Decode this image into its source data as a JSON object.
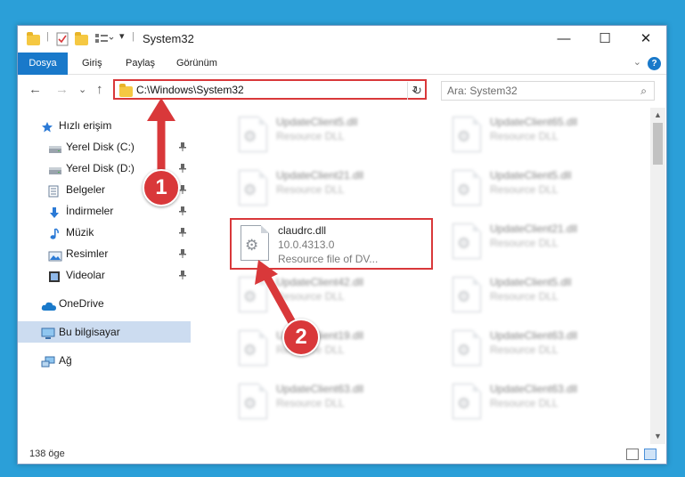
{
  "window": {
    "title": "System32",
    "minimize": "—",
    "maximize": "☐",
    "close": "✕"
  },
  "ribbon": {
    "tabs": [
      "Dosya",
      "Giriş",
      "Paylaş",
      "Görünüm"
    ],
    "collapse": "⌄",
    "help": "?"
  },
  "nav": {
    "back": "←",
    "forward": "→",
    "recent": "⌄",
    "up": "↑",
    "address": "C:\\Windows\\System32",
    "address_dropdown": "⌄",
    "refresh": "↻",
    "search_placeholder": "Ara: System32",
    "search_icon": "⌕"
  },
  "sidebar": {
    "items": [
      {
        "label": "Hızlı erişim",
        "icon": "star-icon",
        "pinned": false
      },
      {
        "label": "Yerel Disk (C:)",
        "icon": "drive-icon",
        "pinned": true
      },
      {
        "label": "Yerel Disk (D:)",
        "icon": "drive-icon",
        "pinned": true
      },
      {
        "label": "Belgeler",
        "icon": "documents-icon",
        "pinned": true
      },
      {
        "label": "İndirmeler",
        "icon": "download-icon",
        "pinned": true
      },
      {
        "label": "Müzik",
        "icon": "music-icon",
        "pinned": true
      },
      {
        "label": "Resimler",
        "icon": "pictures-icon",
        "pinned": true
      },
      {
        "label": "Videolar",
        "icon": "video-icon",
        "pinned": true
      },
      {
        "label": "OneDrive",
        "icon": "cloud-icon",
        "pinned": false
      },
      {
        "label": "Bu bilgisayar",
        "icon": "computer-icon",
        "pinned": false,
        "selected": true
      },
      {
        "label": "Ağ",
        "icon": "network-icon",
        "pinned": false
      }
    ],
    "pin_glyph": "📌"
  },
  "files": [
    {
      "name": "UpdateClient5.dll",
      "line2": "Resource DLL",
      "line3": "",
      "highlight": false
    },
    {
      "name": "UpdateClient65.dll",
      "line2": "Resource DLL",
      "line3": "",
      "highlight": false
    },
    {
      "name": "UpdateClient21.dll",
      "line2": "Resource DLL",
      "line3": "",
      "highlight": false
    },
    {
      "name": "UpdateClient5.dll",
      "line2": "Resource DLL",
      "line3": "",
      "highlight": false
    },
    {
      "name": "claudrc.dll",
      "line2": "10.0.4313.0",
      "line3": "Resource file of DV...",
      "highlight": true
    },
    {
      "name": "UpdateClient21.dll",
      "line2": "Resource DLL",
      "line3": "",
      "highlight": false
    },
    {
      "name": "UpdateClient42.dll",
      "line2": "Resource DLL",
      "line3": "",
      "highlight": false
    },
    {
      "name": "UpdateClient5.dll",
      "line2": "Resource DLL",
      "line3": "",
      "highlight": false
    },
    {
      "name": "UpdateClient19.dll",
      "line2": "Resource DLL",
      "line3": "",
      "highlight": false
    },
    {
      "name": "UpdateClient63.dll",
      "line2": "Resource DLL",
      "line3": "",
      "highlight": false
    },
    {
      "name": "UpdateClient63.dll",
      "line2": "Resource DLL",
      "line3": "",
      "highlight": false
    },
    {
      "name": "UpdateClient63.dll",
      "line2": "Resource DLL",
      "line3": "",
      "highlight": false
    }
  ],
  "status": {
    "count": "138 öge"
  },
  "annotations": {
    "step1": "1",
    "step2": "2"
  },
  "colors": {
    "accent": "#1979ca",
    "highlight": "#d9383a",
    "selected": "#ccdcf0",
    "background": "#2b9fd8"
  }
}
